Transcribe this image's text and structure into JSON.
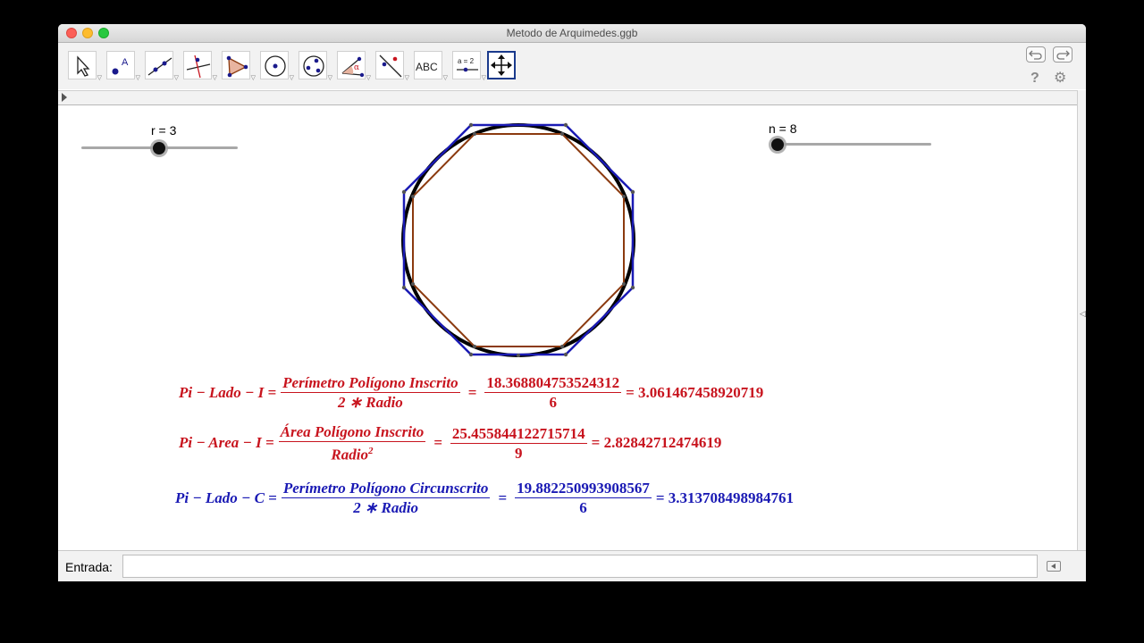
{
  "window": {
    "title": "Metodo de Arquimedes.ggb"
  },
  "toolbar": {
    "tools": [
      {
        "name": "move-tool"
      },
      {
        "name": "point-tool",
        "glyph": "A"
      },
      {
        "name": "line-tool"
      },
      {
        "name": "perpendicular-line-tool"
      },
      {
        "name": "polygon-tool"
      },
      {
        "name": "circle-tool"
      },
      {
        "name": "circle-three-points-tool"
      },
      {
        "name": "angle-tool",
        "glyph": "α"
      },
      {
        "name": "reflect-tool"
      },
      {
        "name": "text-tool",
        "glyph": "ABC"
      },
      {
        "name": "slider-tool",
        "glyph": "a = 2"
      },
      {
        "name": "move-graphics-view-tool"
      }
    ],
    "help_glyph": "?",
    "settings_glyph": "⚙"
  },
  "sliders": {
    "r": {
      "label": "r = 3",
      "value": 3
    },
    "n": {
      "label": "n = 8",
      "value": 8
    }
  },
  "colors": {
    "inscribed": "#8b3a0f",
    "circumscribed": "#1a1ab4",
    "circle": "#000000",
    "red_text": "#c8141e",
    "blue_text": "#1a1ab4"
  },
  "formulas": {
    "f1": {
      "lhs": "Pi − Lado − I =",
      "num": "Perímetro Polígono Inscrito",
      "den": "2 ∗ Radio",
      "eq1": "=",
      "vnum": "18.368804753524312",
      "vden": "6",
      "result": "= 3.061467458920719"
    },
    "f2": {
      "lhs": "Pi − Area − I =",
      "num": "Área Polígono Inscrito",
      "den_base": "Radio",
      "den_exp": "2",
      "eq1": "=",
      "vnum": "25.455844122715714",
      "vden": "9",
      "result": "= 2.82842712474619"
    },
    "f3": {
      "lhs": "Pi − Lado − C =",
      "num": "Perímetro Polígono Circunscrito",
      "den": "2 ∗ Radio",
      "eq1": "=",
      "vnum": "19.882250993908567",
      "vden": "6",
      "result": "= 3.313708498984761"
    }
  },
  "input": {
    "label": "Entrada:",
    "value": ""
  }
}
